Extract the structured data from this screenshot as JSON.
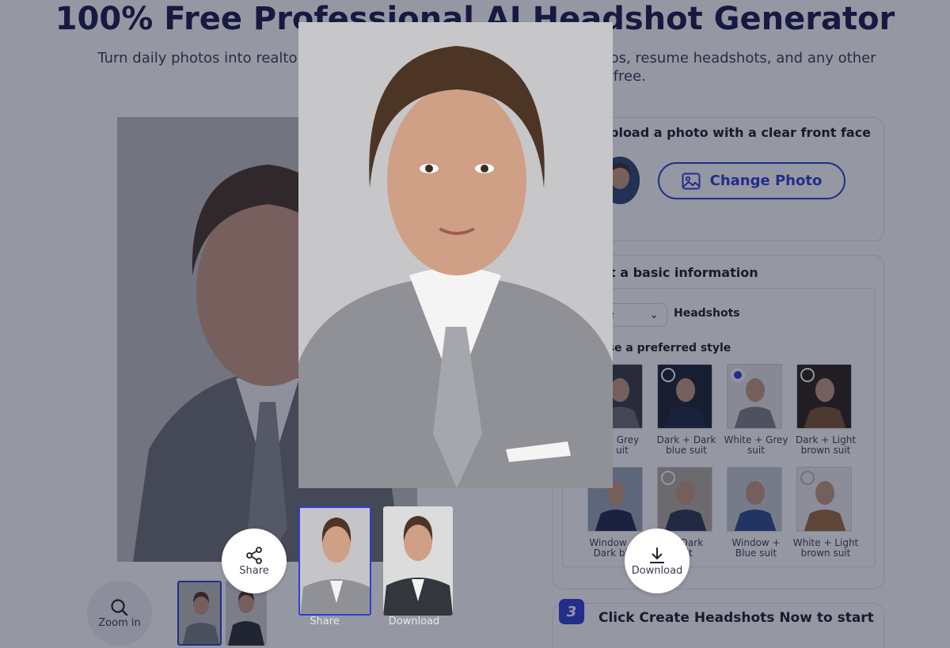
{
  "hero": {
    "title": "100% Free Professional AI Headshot Generator",
    "subtitle_part1": "Turn daily photos into realtor he",
    "subtitle_part2": "hotos, resume headshots, and any other",
    "subtitle_part3": "for free."
  },
  "step1": {
    "title": "pload a photo with a clear front face",
    "change_photo_label": "Change Photo"
  },
  "step2": {
    "title": "t a basic information",
    "select_value": "e",
    "headshots_label": "Headshots",
    "style_prompt": "ose a preferred style",
    "styles": [
      {
        "label_line1": "+ Grey",
        "label_line2": "uit",
        "selected": false
      },
      {
        "label_line1": "Dark + Dark",
        "label_line2": "blue suit",
        "selected": false
      },
      {
        "label_line1": "White + Grey",
        "label_line2": "suit",
        "selected": true
      },
      {
        "label_line1": "Dark + Light",
        "label_line2": "brown suit",
        "selected": false
      },
      {
        "label_line1": "Window +",
        "label_line2": "Dark blu",
        "selected": false
      },
      {
        "label_line1": "+ Dark",
        "label_line2": "uit",
        "selected": false
      },
      {
        "label_line1": "Window +",
        "label_line2": "Blue suit",
        "selected": false
      },
      {
        "label_line1": "White + Light",
        "label_line2": "brown suit",
        "selected": false
      }
    ]
  },
  "step3": {
    "number": "3",
    "text": "Click Create Headshots Now to start"
  },
  "controls": {
    "zoom_label": "Zoom in",
    "share_label": "Share",
    "download_label": "Download"
  },
  "popup": {
    "share_label": "Share",
    "download_label": "Download",
    "thumb_share_label": "Share",
    "thumb_download_label": "Download"
  },
  "colors": {
    "accent": "#2f3ed8",
    "title": "#1d1a4d",
    "overlay": "rgba(20,24,48,0.45)"
  }
}
